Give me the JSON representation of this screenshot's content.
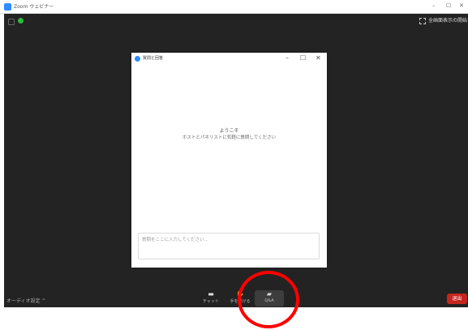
{
  "window": {
    "title": "Zoom ウェビナー",
    "minimize": "–",
    "maximize": "☐",
    "close": "✕"
  },
  "meeting": {
    "fullscreen_label": "全画面表示の開始",
    "audio_settings": "オーディオ設定",
    "audio_caret": "^",
    "leave_label": "退出"
  },
  "toolbar": {
    "items": [
      {
        "label": "チャット",
        "icon": "chat-icon"
      },
      {
        "label": "手を挙げる",
        "icon": "raise-hand-icon"
      },
      {
        "label": "Q&A",
        "icon": "qa-icon"
      }
    ]
  },
  "qa_dialog": {
    "title": "質問と回答",
    "minimize": "–",
    "maximize": "☐",
    "close": "✕",
    "welcome": "ようこそ",
    "welcome_sub": "ホストとパネリストに気軽に質問してください",
    "input_placeholder": "質問をここに入力してください..."
  },
  "colors": {
    "meeting_bg": "#232323",
    "leave": "#c7251f",
    "highlight": "#ff0000",
    "brand": "#2d8cff"
  }
}
